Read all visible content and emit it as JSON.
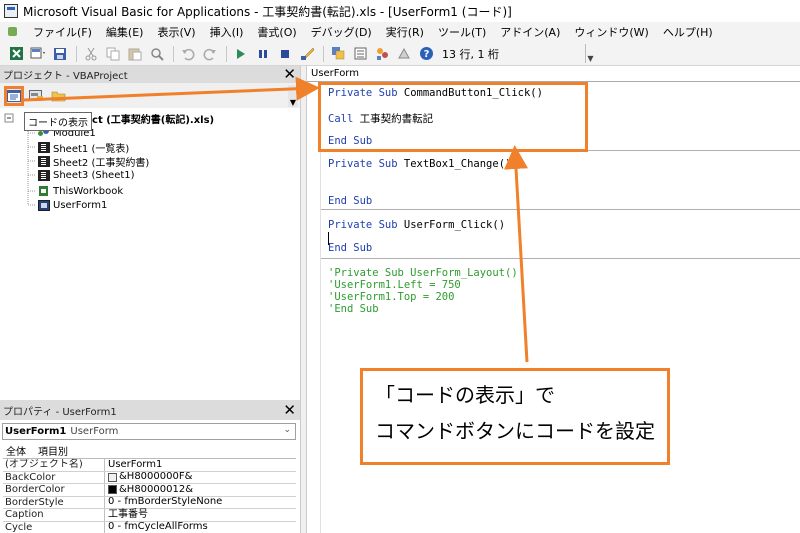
{
  "window": {
    "title": "Microsoft Visual Basic for Applications - 工事契約書(転記).xls - [UserForm1 (コード)]"
  },
  "menu": [
    "ファイル(F)",
    "編集(E)",
    "表示(V)",
    "挿入(I)",
    "書式(O)",
    "デバッグ(D)",
    "実行(R)",
    "ツール(T)",
    "アドイン(A)",
    "ウィンドウ(W)",
    "ヘルプ(H)"
  ],
  "toolbar": {
    "status": "13 行, 1 桁",
    "icons": [
      "excel-icon",
      "insert-icon",
      "save-icon",
      "cut-icon",
      "copy-icon",
      "paste-icon",
      "find-icon",
      "undo-icon",
      "redo-icon",
      "run-icon",
      "break-icon",
      "reset-icon",
      "design-mode-icon",
      "project-explorer-icon",
      "properties-icon",
      "object-browser-icon",
      "toolbox-icon",
      "help-icon"
    ]
  },
  "project_pane": {
    "title": "プロジェクト - VBAProject",
    "tooltip": "コードの表示",
    "root": "roject (工事契約書(転記).xls)",
    "items": [
      "Module1",
      "Sheet1 (一覧表)",
      "Sheet2 (工事契約書)",
      "Sheet3 (Sheet1)",
      "ThisWorkbook",
      "UserForm1"
    ]
  },
  "properties_pane": {
    "title": "プロパティ - UserForm1",
    "object_name": "UserForm1",
    "object_type": "UserForm",
    "tabs": [
      "全体",
      "項目別"
    ],
    "rows": [
      {
        "name": "(オブジェクト名)",
        "value": "UserForm1"
      },
      {
        "name": "BackColor",
        "value": "&H8000000F&",
        "swatch": "#f0f0f0"
      },
      {
        "name": "BorderColor",
        "value": "&H80000012&",
        "swatch": "#000000"
      },
      {
        "name": "BorderStyle",
        "value": "0 - fmBorderStyleNone"
      },
      {
        "name": "Caption",
        "value": "工事番号"
      },
      {
        "name": "Cycle",
        "value": "0 - fmCycleAllForms"
      }
    ]
  },
  "code_window": {
    "object": "UserForm",
    "lines": {
      "l1_kw": "Private Sub",
      "l1_rest": " CommandButton1_Click()",
      "l2_kw": "Call",
      "l2_rest": " 工事契約書転記",
      "l3": "End Sub",
      "l4_kw": "Private Sub",
      "l4_rest": " TextBox1_Change()",
      "l5": "End Sub",
      "l6_kw": "Private Sub",
      "l6_rest": " UserForm_Click()",
      "l7": "End Sub",
      "c1": "'Private Sub UserForm_Layout()",
      "c2": "'UserForm1.Left = 750",
      "c3": "'UserForm1.Top = 200",
      "c4": "'End Sub"
    }
  },
  "annotation": {
    "line1": "「コードの表示」で",
    "line2": "コマンドボタンにコードを設定",
    "color": "#f0802a"
  }
}
